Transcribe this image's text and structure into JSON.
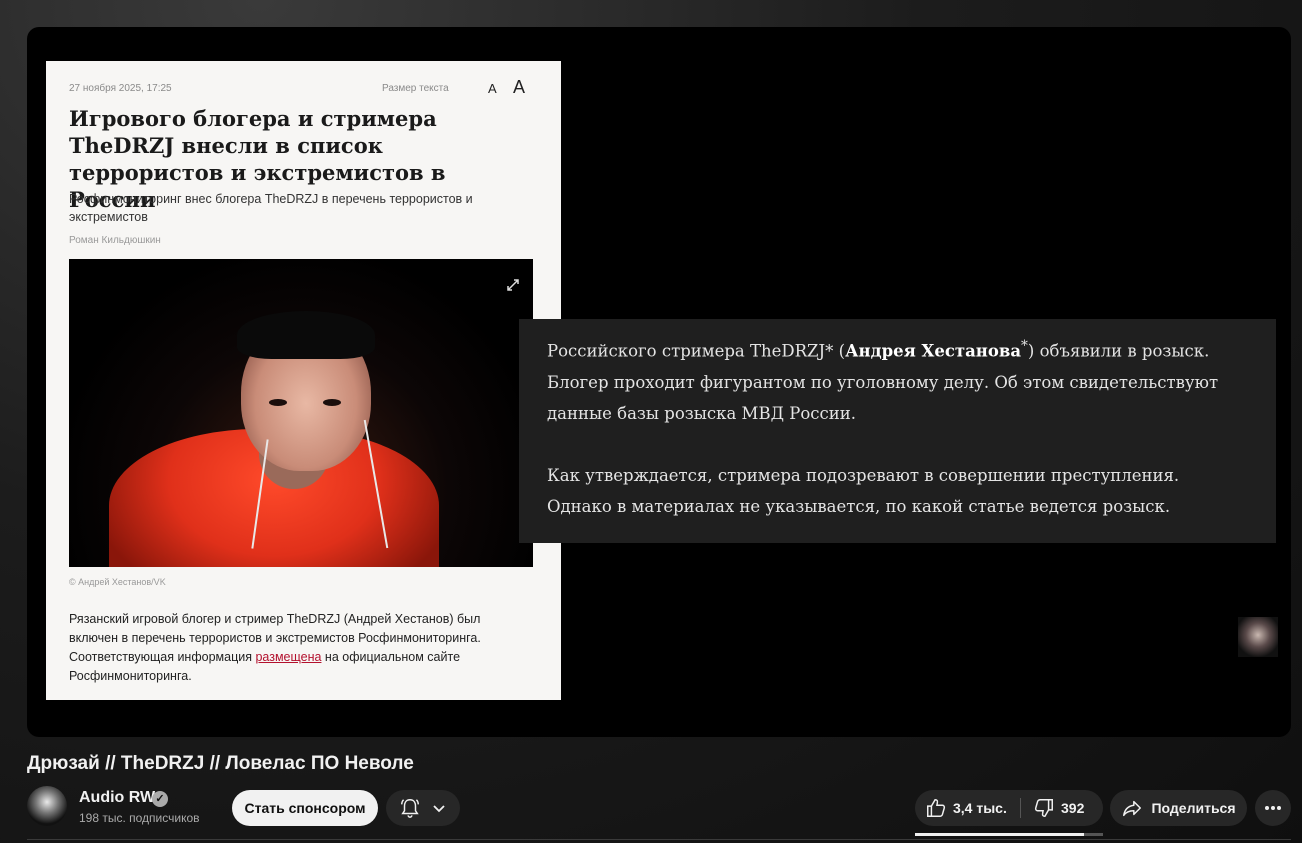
{
  "article": {
    "date": "27 ноября 2025, 17:25",
    "text_size_label": "Размер текста",
    "size_small": "A",
    "size_large": "A",
    "title": "Игрового блогера и стримера TheDRZJ внесли в список террористов и экстремистов в России",
    "subtitle": "Росфинмониторинг внес блогера TheDRZJ в перечень террористов и экстремистов",
    "author": "Роман Кильдюшкин",
    "photo_credit": "© Андрей Хестанов/VK",
    "body_before_link": "Рязанский игровой блогер и стример TheDRZJ (Андрей Хестанов) был включен в перечень террористов и экстремистов Росфинмониторинга. Соответствующая информация ",
    "body_link": "размещена",
    "body_after_link": " на официальном сайте Росфинмониторинга."
  },
  "quote": {
    "p1_start": "Российского стримера TheDRZJ* (",
    "p1_bold": "Андрея Хестанова",
    "p1_star": "*",
    "p1_end": ") объявили в розыск. Блогер проходит фигурантом по уголовному делу. Об этом свидетельствуют данные базы розыска МВД России.",
    "p2": "Как утверждается, стримера подозревают в совершении преступления. Однако в материалах не указывается, по какой статье ведется розыск."
  },
  "video": {
    "title": "Дрюзай // TheDRZJ // Ловелас ПО Неволе"
  },
  "channel": {
    "name": "Audio RW",
    "subscribers": "198 тыс. подписчиков",
    "sponsor_label": "Стать спонсором"
  },
  "actions": {
    "likes": "3,4 тыс.",
    "dislikes": "392",
    "share_label": "Поделиться",
    "like_ratio": 0.9
  },
  "icons": {
    "verified": "verified-check-icon",
    "bell": "bell-icon",
    "chevron": "chevron-down-icon",
    "like": "thumbs-up-icon",
    "dislike": "thumbs-down-icon",
    "share": "share-arrow-icon",
    "more": "more-horizontal-icon",
    "expand": "expand-icon"
  }
}
